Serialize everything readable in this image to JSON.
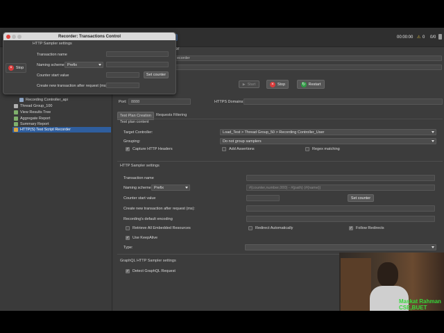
{
  "topbar": {
    "timer": "00:00:00",
    "warning_count": "0",
    "error_ratio": "0/0"
  },
  "popup": {
    "title": "Recorder: Transactions Control",
    "stop_label": "Stop",
    "section": "HTTP Sampler settings",
    "transaction_name_label": "Transaction name",
    "naming_scheme_label": "Naming scheme",
    "naming_scheme_value": "Prefix",
    "counter_start_label": "Counter start value",
    "set_counter_label": "Set counter",
    "create_new_label": "Create new transaction after request (ms):"
  },
  "right_header": {
    "name_value_fragment": "er",
    "comments_value_fragment": "ecorder"
  },
  "state_buttons": {
    "start": "Start",
    "stop": "Stop",
    "restart": "Restart"
  },
  "tree": {
    "items": [
      {
        "label": "Recording Controller_api",
        "icon_color": "#8fa7c7"
      },
      {
        "label": "Thread Group_100",
        "icon_color": "#b0b0b0"
      },
      {
        "label": "View Results Tree",
        "icon_color": "#7fb06c"
      },
      {
        "label": "Aggregate Report",
        "icon_color": "#7fb06c"
      },
      {
        "label": "Summary Report",
        "icon_color": "#7fb06c"
      },
      {
        "label": "HTTP(S) Test Script Recorder",
        "icon_color": "#d9a441"
      }
    ]
  },
  "settings": {
    "port_label": "Port:",
    "port_value": "8888",
    "https_label": "HTTPS Domains:",
    "tabs": [
      "Test Plan Creation",
      "Requests Filtering"
    ],
    "test_plan_content": "Test plan content",
    "target_controller_label": "Target Controller:",
    "target_controller_value": "Load_Test > Thread Group_50 > Recording Controller_User",
    "grouping_label": "Grouping:",
    "grouping_value": "Do not group samplers",
    "capture_headers": "Capture HTTP Headers",
    "add_assertions": "Add Assertions",
    "regex_matching": "Regex matching",
    "http_sampler_settings": "HTTP Sampler settings",
    "transaction_name_label": "Transaction name",
    "naming_scheme_label": "Naming scheme",
    "naming_scheme_value": "Prefix",
    "naming_pattern": "#{counter,number,000} - #{path} (#{name})",
    "counter_start_label": "Counter start value",
    "set_counter_label": "Set counter",
    "create_new_label": "Create new transaction after request (ms):",
    "encoding_label": "Recording's default encoding",
    "retrieve_embedded": "Retrieve All Embedded Resources",
    "redirect_auto": "Redirect Automatically",
    "follow_redirects": "Follow Redirects",
    "use_keepalive": "Use KeepAlive",
    "type_label": "Type:",
    "graphql_settings": "GraphQL HTTP Sampler settings",
    "detect_graphql": "Detect GraphQL Request"
  },
  "overlay": {
    "name_line1": "Maskat Rahman",
    "name_line2": "CSE,BUET"
  },
  "colors": {
    "stop_red": "#d93a3a",
    "restart_green": "#2f9a44",
    "selection_blue": "#2f5e9e",
    "overlay_green": "#36d93a"
  }
}
